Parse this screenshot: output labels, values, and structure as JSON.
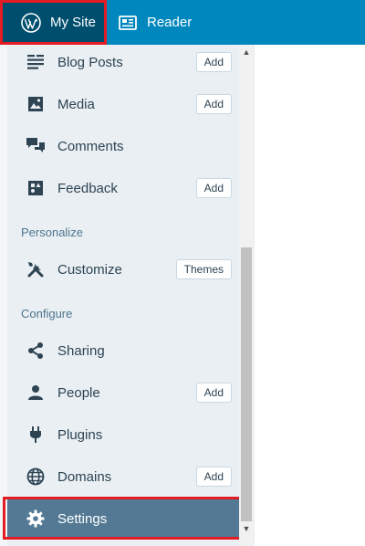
{
  "topbar": {
    "my_site_label": "My Site",
    "reader_label": "Reader"
  },
  "menu": {
    "blog_posts": {
      "label": "Blog Posts",
      "button": "Add",
      "icon": "posts-icon"
    },
    "media": {
      "label": "Media",
      "button": "Add",
      "icon": "image-icon"
    },
    "comments": {
      "label": "Comments",
      "icon": "comments-icon"
    },
    "feedback": {
      "label": "Feedback",
      "button": "Add",
      "icon": "feedback-icon"
    },
    "personalize_heading": "Personalize",
    "customize": {
      "label": "Customize",
      "button": "Themes",
      "icon": "tools-icon"
    },
    "configure_heading": "Configure",
    "sharing": {
      "label": "Sharing",
      "icon": "share-icon"
    },
    "people": {
      "label": "People",
      "button": "Add",
      "icon": "person-icon"
    },
    "plugins": {
      "label": "Plugins",
      "icon": "plug-icon"
    },
    "domains": {
      "label": "Domains",
      "button": "Add",
      "icon": "globe-icon"
    },
    "settings": {
      "label": "Settings",
      "icon": "cog-icon"
    }
  },
  "colors": {
    "topbar": "#0087be",
    "active_tab": "#004e6e",
    "sidebar_bg": "#e9eff3",
    "selected_item": "#537994",
    "highlight": "#e31b23"
  }
}
